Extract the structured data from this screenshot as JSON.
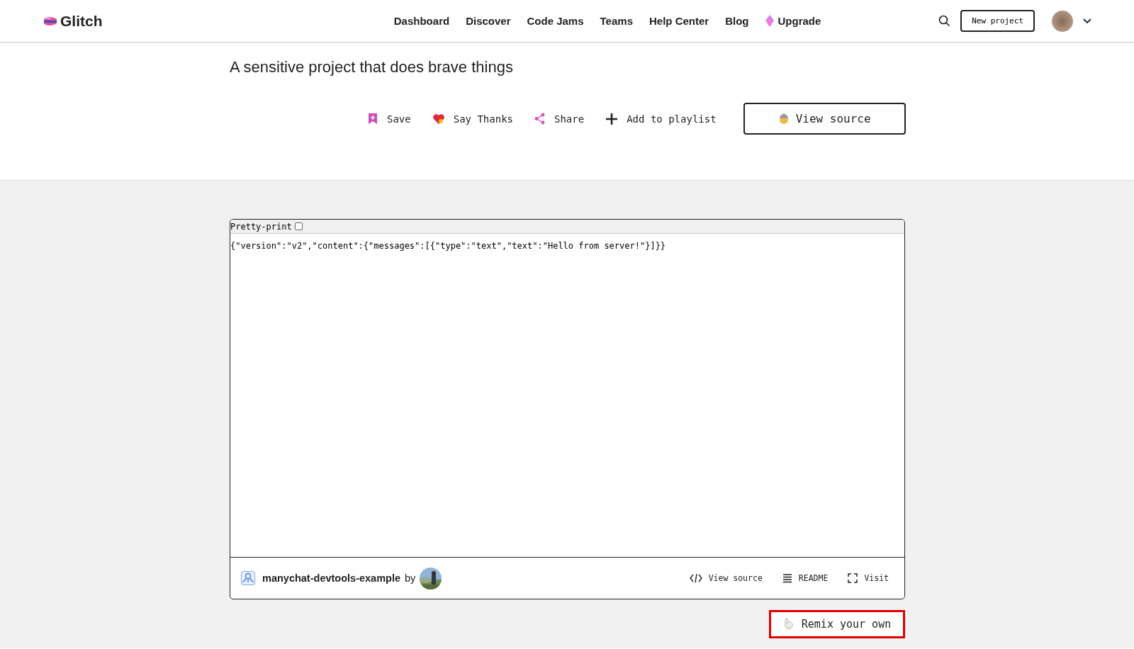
{
  "header": {
    "logo": "Glitch",
    "nav": [
      {
        "label": "Dashboard",
        "kind": "link"
      },
      {
        "label": "Discover",
        "kind": "link"
      },
      {
        "label": "Code Jams",
        "kind": "link"
      },
      {
        "label": "Teams",
        "kind": "link"
      },
      {
        "label": "Help Center",
        "kind": "link"
      },
      {
        "label": "Blog",
        "kind": "link"
      },
      {
        "label": "Upgrade",
        "kind": "upgrade"
      }
    ],
    "new_project": "New project"
  },
  "project": {
    "description": "A sensitive project that does brave things",
    "actions": [
      {
        "label": "Save",
        "kind": "save"
      },
      {
        "label": "Say Thanks",
        "kind": "thanks"
      },
      {
        "label": "Share",
        "kind": "share"
      },
      {
        "label": "Add to playlist",
        "kind": "add"
      }
    ],
    "view_source": "View source"
  },
  "embed": {
    "pretty_print": {
      "label": "Pretty-print",
      "checked": false
    },
    "content": "{\"version\":\"v2\",\"content\":{\"messages\":[{\"type\":\"text\",\"text\":\"Hello from server!\"}]}}",
    "project_name": "manychat-devtools-example",
    "by": "by",
    "links": [
      {
        "label": "View source",
        "kind": "code"
      },
      {
        "label": "README",
        "kind": "readme"
      },
      {
        "label": "Visit",
        "kind": "visit"
      }
    ]
  },
  "remix": "Remix your own"
}
